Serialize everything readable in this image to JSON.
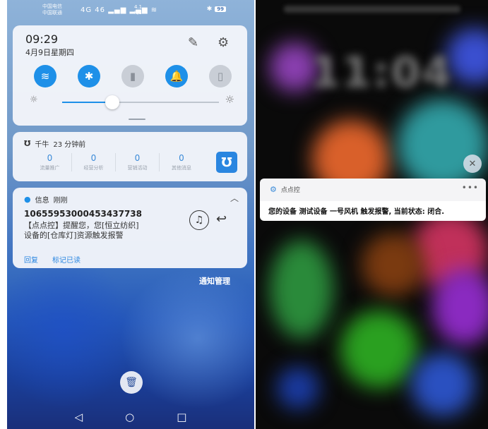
{
  "left": {
    "status": {
      "carrier1": "中国电信",
      "carrier2": "中国联通",
      "signal": "4G 46",
      "speed_value": "4.1",
      "speed_unit": "K/s",
      "battery": "99"
    },
    "quick_settings": {
      "time": "09:29",
      "date": "4月9日星期四",
      "brightness_percent": 32
    },
    "qianniu": {
      "app": "千牛",
      "time_ago": "23 分钟前",
      "stats": [
        {
          "value": "0",
          "label": "流量推广"
        },
        {
          "value": "0",
          "label": "经营分析"
        },
        {
          "value": "0",
          "label": "营销活动"
        },
        {
          "value": "0",
          "label": "其他消息"
        }
      ]
    },
    "message": {
      "app": "信息",
      "time": "刚刚",
      "sender": "10655953000453437738",
      "line1": "【点点控】提醒您，您[恒立纺织]",
      "line2": "设备的[仓库灯]资源触发报警",
      "reply": "回复",
      "mark_read": "标记已读"
    },
    "notification_mgmt": "通知管理"
  },
  "right": {
    "clock": "11:04",
    "popup": {
      "app": "点点控",
      "text": "您的设备 测试设备 一号风机 触发报警, 当前状态: 闭合."
    }
  },
  "colors": {
    "accent": "#1e90e8",
    "card_bg": "#f2f5fa"
  }
}
